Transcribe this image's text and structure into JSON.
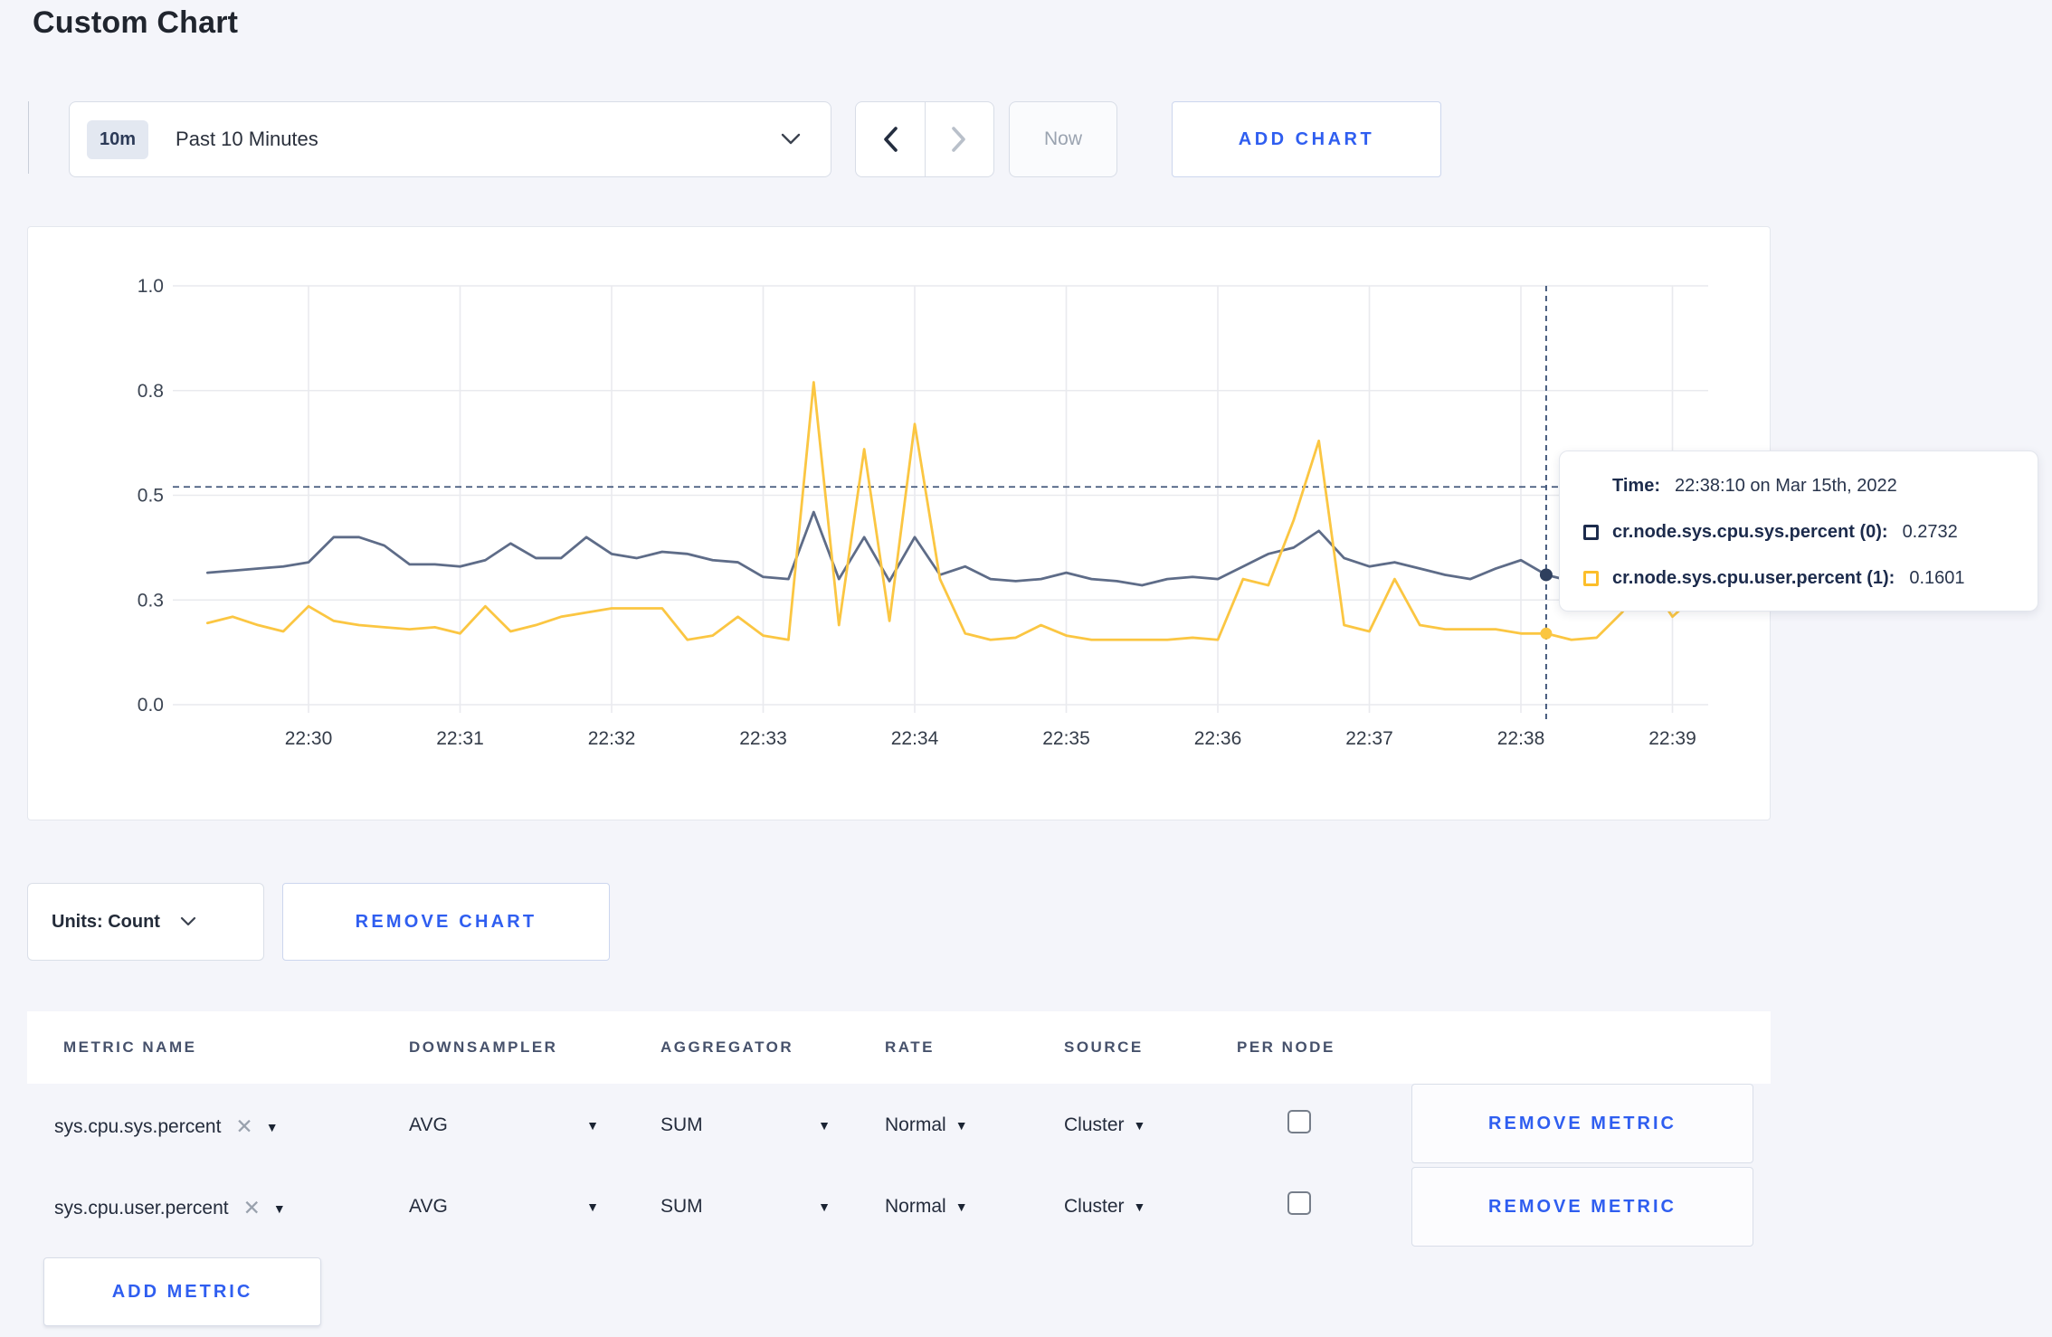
{
  "page": {
    "title": "Custom Chart"
  },
  "toolbar": {
    "time_badge": "10m",
    "time_label": "Past 10 Minutes",
    "prev_label": "previous time window",
    "next_label": "next time window",
    "now_label": "Now",
    "add_chart_label": "ADD CHART"
  },
  "chart_data": {
    "type": "line",
    "title": "",
    "xlabel": "",
    "ylabel": "",
    "ylim": [
      0,
      1
    ],
    "grid": true,
    "legend_position": "tooltip",
    "x_ticks": [
      "22:30",
      "22:31",
      "22:32",
      "22:33",
      "22:34",
      "22:35",
      "22:36",
      "22:37",
      "22:38",
      "22:39"
    ],
    "y_tick_labels": [
      "0.0",
      "0.3",
      "0.5",
      "0.8",
      "1.0"
    ],
    "y_tick_values": [
      0,
      0.25,
      0.5,
      0.75,
      1.0
    ],
    "x_start_offset_seconds": -40,
    "x_step_seconds": 10,
    "guide_value": 0.52,
    "crosshair": {
      "index": 53,
      "time": "22:38:10"
    },
    "series": [
      {
        "name": "cr.node.sys.cpu.sys.percent (0)",
        "color": "#5e6c88",
        "values": [
          0.315,
          0.32,
          0.325,
          0.33,
          0.34,
          0.4,
          0.4,
          0.38,
          0.335,
          0.335,
          0.33,
          0.345,
          0.385,
          0.35,
          0.35,
          0.4,
          0.36,
          0.35,
          0.365,
          0.36,
          0.345,
          0.34,
          0.305,
          0.3,
          0.46,
          0.3,
          0.4,
          0.295,
          0.4,
          0.31,
          0.33,
          0.3,
          0.295,
          0.3,
          0.315,
          0.3,
          0.295,
          0.285,
          0.3,
          0.305,
          0.3,
          0.33,
          0.36,
          0.375,
          0.415,
          0.35,
          0.33,
          0.34,
          0.325,
          0.31,
          0.3,
          0.325,
          0.345,
          0.31,
          0.295,
          0.3,
          0.315,
          0.305,
          0.3,
          0.315
        ]
      },
      {
        "name": "cr.node.sys.cpu.user.percent (1)",
        "color": "#fbc642",
        "values": [
          0.195,
          0.21,
          0.19,
          0.175,
          0.235,
          0.2,
          0.19,
          0.185,
          0.18,
          0.185,
          0.17,
          0.235,
          0.175,
          0.19,
          0.21,
          0.22,
          0.23,
          0.23,
          0.23,
          0.155,
          0.165,
          0.21,
          0.165,
          0.155,
          0.77,
          0.19,
          0.61,
          0.2,
          0.67,
          0.3,
          0.17,
          0.155,
          0.16,
          0.19,
          0.165,
          0.155,
          0.155,
          0.155,
          0.155,
          0.16,
          0.155,
          0.3,
          0.285,
          0.44,
          0.63,
          0.19,
          0.175,
          0.3,
          0.19,
          0.18,
          0.18,
          0.18,
          0.17,
          0.17,
          0.155,
          0.16,
          0.22,
          0.3,
          0.21,
          0.265
        ]
      }
    ]
  },
  "tooltip": {
    "time_label": "Time:",
    "time_value": "22:38:10 on Mar 15th, 2022",
    "series": [
      {
        "label": "cr.node.sys.cpu.sys.percent (0):",
        "value": "0.2732",
        "color": "#1c2b4c"
      },
      {
        "label": "cr.node.sys.cpu.user.percent (1):",
        "value": "0.1601",
        "color": "#fcbe2a"
      }
    ]
  },
  "chart_controls": {
    "units_label": "Units: Count",
    "remove_chart_label": "REMOVE CHART"
  },
  "metrics_table": {
    "headers": [
      "METRIC NAME",
      "DOWNSAMPLER",
      "AGGREGATOR",
      "RATE",
      "SOURCE",
      "PER NODE"
    ],
    "rows": [
      {
        "metric": "sys.cpu.sys.percent",
        "downsampler": "AVG",
        "aggregator": "SUM",
        "rate": "Normal",
        "source": "Cluster",
        "per_node_checked": false,
        "remove_label": "REMOVE METRIC"
      },
      {
        "metric": "sys.cpu.user.percent",
        "downsampler": "AVG",
        "aggregator": "SUM",
        "rate": "Normal",
        "source": "Cluster",
        "per_node_checked": false,
        "remove_label": "REMOVE METRIC"
      }
    ],
    "add_metric_label": "ADD METRIC"
  },
  "colors": {
    "accent_blue": "#2f5ef0",
    "series_sys": "#5e6c88",
    "series_user": "#fbc642",
    "crosshair": "#44597c",
    "grid": "#e9eaee"
  }
}
